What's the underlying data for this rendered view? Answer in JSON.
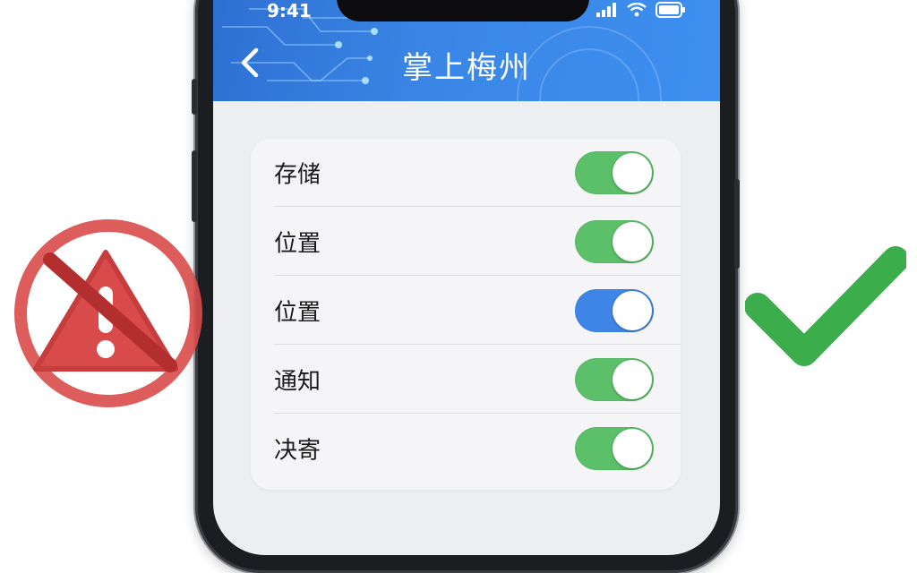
{
  "status_bar": {
    "time": "9:41"
  },
  "header": {
    "title": "掌上梅州"
  },
  "settings": [
    {
      "label": "存储",
      "enabled": true,
      "color": "#5cc06a"
    },
    {
      "label": "位置",
      "enabled": true,
      "color": "#5cc06a"
    },
    {
      "label": "位置",
      "enabled": true,
      "color": "#3f85e8"
    },
    {
      "label": "通知",
      "enabled": true,
      "color": "#5cc06a"
    },
    {
      "label": "决寄",
      "enabled": true,
      "color": "#5cc06a"
    }
  ],
  "icons": {
    "back": "chevron-left-icon",
    "signal": "signal-icon",
    "wifi": "wifi-icon",
    "battery": "battery-icon",
    "prohibited_warning": "prohibited-warning-icon",
    "checkmark": "checkmark-icon"
  },
  "colors": {
    "header_blue": "#3a86e6",
    "toggle_green": "#5cc06a",
    "toggle_blue": "#3f85e8",
    "warning_red": "#d94a4a",
    "check_green": "#3bad4a"
  }
}
